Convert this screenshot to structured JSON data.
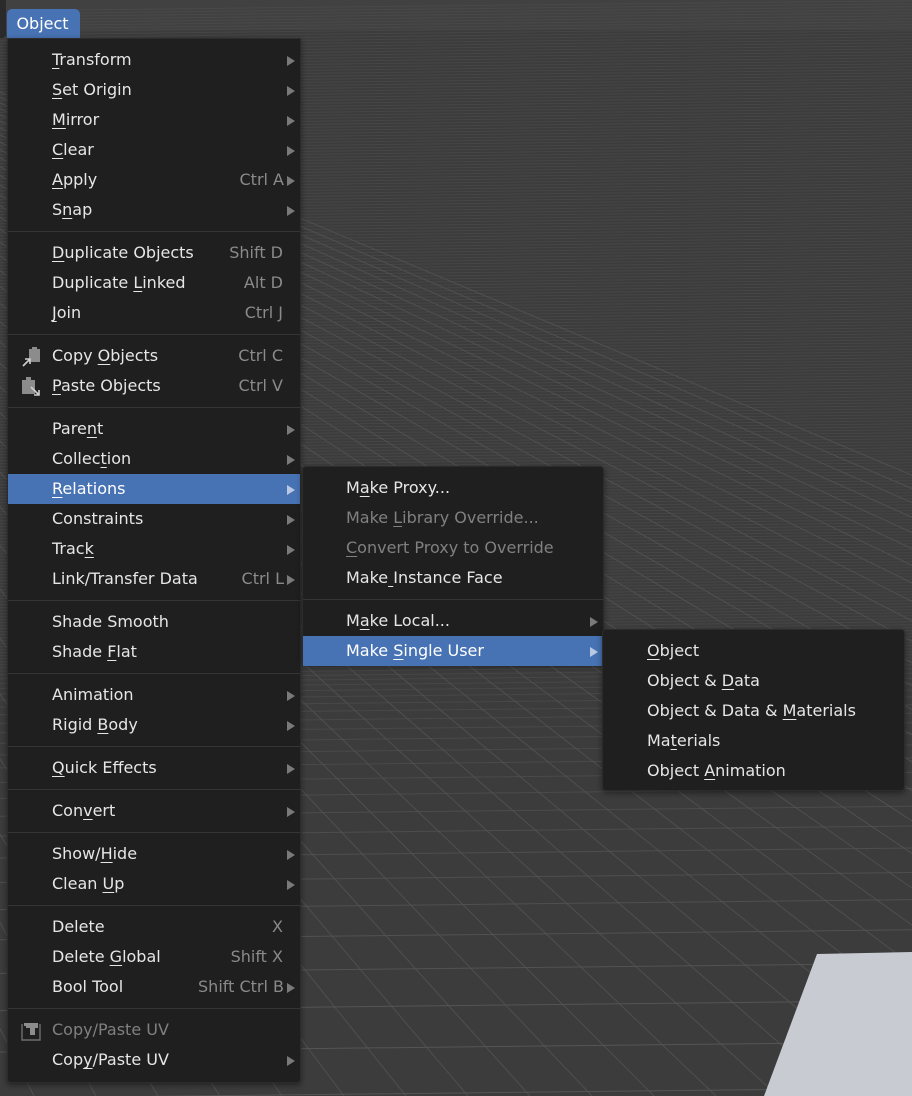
{
  "header": {
    "menu_button": "Object"
  },
  "colors": {
    "accent": "#4772b3",
    "menu_bg": "#1f1f1f",
    "viewport_bg": "#3c3c3c",
    "text": "#e6e6e6",
    "disabled_text": "#808080",
    "shortcut_text": "#8a8a8a"
  },
  "main_menu": {
    "groups": [
      [
        {
          "label": "Transform",
          "u": 0,
          "submenu": true
        },
        {
          "label": "Set Origin",
          "u": 0,
          "submenu": true
        },
        {
          "label": "Mirror",
          "u": 0,
          "submenu": true
        },
        {
          "label": "Clear",
          "u": 0,
          "submenu": true
        },
        {
          "label": "Apply",
          "u": 0,
          "shortcut": "Ctrl A",
          "submenu": true
        },
        {
          "label": "Snap",
          "u": 1,
          "submenu": true
        }
      ],
      [
        {
          "label": "Duplicate Objects",
          "u": 0,
          "shortcut": "Shift D"
        },
        {
          "label": "Duplicate Linked",
          "u": 10,
          "shortcut": "Alt D"
        },
        {
          "label": "Join",
          "u": 0,
          "shortcut": "Ctrl J"
        }
      ],
      [
        {
          "label": "Copy Objects",
          "u": 5,
          "shortcut": "Ctrl C",
          "icon": "copy-icon"
        },
        {
          "label": "Paste Objects",
          "u": 0,
          "shortcut": "Ctrl V",
          "icon": "paste-icon"
        }
      ],
      [
        {
          "label": "Parent",
          "u": 4,
          "submenu": true
        },
        {
          "label": "Collection",
          "u": 6,
          "submenu": true
        },
        {
          "label": "Relations",
          "u": 0,
          "submenu": true,
          "highlighted": true
        },
        {
          "label": "Constraints",
          "submenu": true
        },
        {
          "label": "Track",
          "u": 4,
          "submenu": true
        },
        {
          "label": "Link/Transfer Data",
          "shortcut": "Ctrl L",
          "submenu": true
        }
      ],
      [
        {
          "label": "Shade Smooth"
        },
        {
          "label": "Shade Flat",
          "u": 6
        }
      ],
      [
        {
          "label": "Animation",
          "submenu": true
        },
        {
          "label": "Rigid Body",
          "u": 6,
          "submenu": true
        }
      ],
      [
        {
          "label": "Quick Effects",
          "u": 0,
          "submenu": true
        }
      ],
      [
        {
          "label": "Convert",
          "u": 3,
          "submenu": true
        }
      ],
      [
        {
          "label": "Show/Hide",
          "u": 5,
          "submenu": true
        },
        {
          "label": "Clean Up",
          "u": 6,
          "submenu": true
        }
      ],
      [
        {
          "label": "Delete",
          "shortcut": "X"
        },
        {
          "label": "Delete Global",
          "u": 7,
          "shortcut": "Shift X"
        },
        {
          "label": "Bool Tool",
          "shortcut": "Shift Ctrl B",
          "submenu": true
        }
      ],
      [
        {
          "label": "Copy/Paste UV",
          "disabled": true,
          "icon": "uv-copy-paste-icon"
        },
        {
          "label": "Copy/Paste UV",
          "u": 3,
          "submenu": true
        }
      ]
    ]
  },
  "relations_menu": {
    "groups": [
      [
        {
          "label": "Make Proxy...",
          "u": 1
        },
        {
          "label": "Make Library Override...",
          "u": 5,
          "disabled": true
        },
        {
          "label": "Convert Proxy to Override",
          "u": 0,
          "disabled": true
        },
        {
          "label": "Make Instance Face",
          "u": 4
        }
      ],
      [
        {
          "label": "Make Local...",
          "u": 1,
          "submenu": true
        },
        {
          "label": "Make Single User",
          "u": 5,
          "submenu": true,
          "highlighted": true
        }
      ]
    ]
  },
  "single_user_menu": {
    "groups": [
      [
        {
          "label": "Object",
          "u": 0
        },
        {
          "label": "Object & Data",
          "u": 9
        },
        {
          "label": "Object & Data & Materials",
          "u": 16
        },
        {
          "label": "Materials",
          "u": 2
        },
        {
          "label": "Object Animation",
          "u": 7
        }
      ]
    ]
  }
}
